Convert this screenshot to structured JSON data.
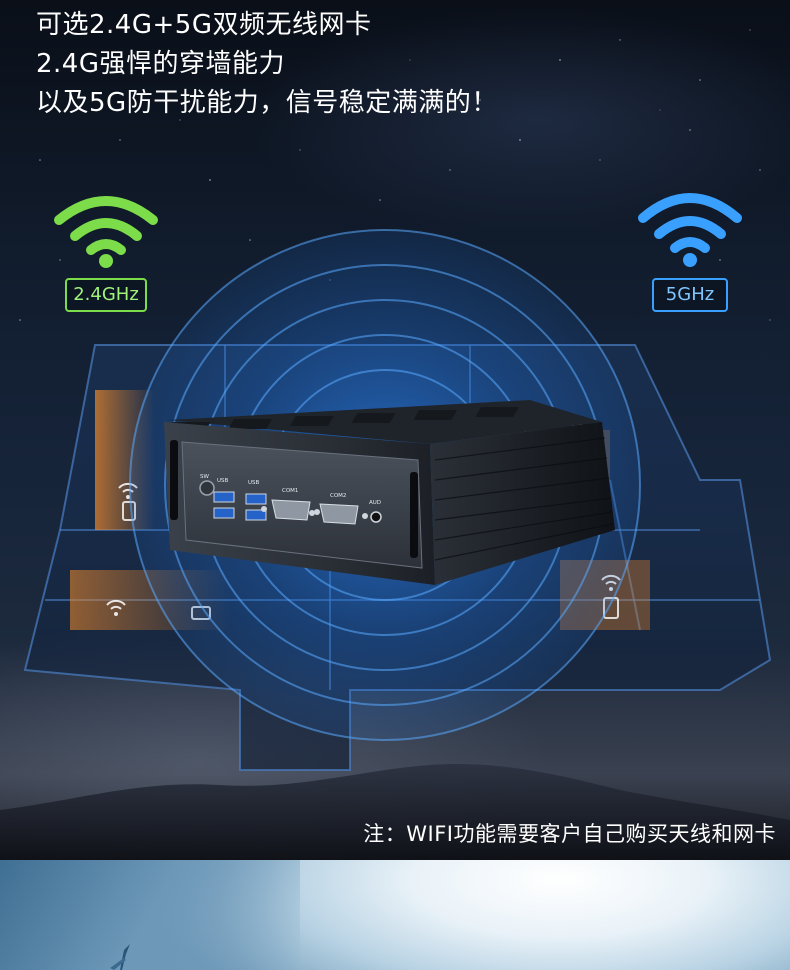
{
  "headline": {
    "line1": "可选2.4G+5G双频无线网卡",
    "line2": "2.4G强悍的穿墙能力",
    "line3": "以及5G防干扰能力，信号稳定满满的！"
  },
  "wifi_badges": [
    {
      "label": "2.4GHz",
      "color": "#7cdc4a",
      "icon": "wifi-icon"
    },
    {
      "label": "5GHz",
      "color": "#3aa0ff",
      "icon": "wifi-icon"
    }
  ],
  "device_ports": {
    "sw": "SW",
    "usb1": "USB",
    "usb2": "USB",
    "com1": "COM1",
    "com2": "COM2",
    "aud": "AUD"
  },
  "note": "注：WIFI功能需要客户自己购买天线和网卡",
  "colors": {
    "ring_blue": "#2f8cff",
    "wifi_green": "#7cdc4a",
    "wifi_blue": "#3aa0ff"
  }
}
